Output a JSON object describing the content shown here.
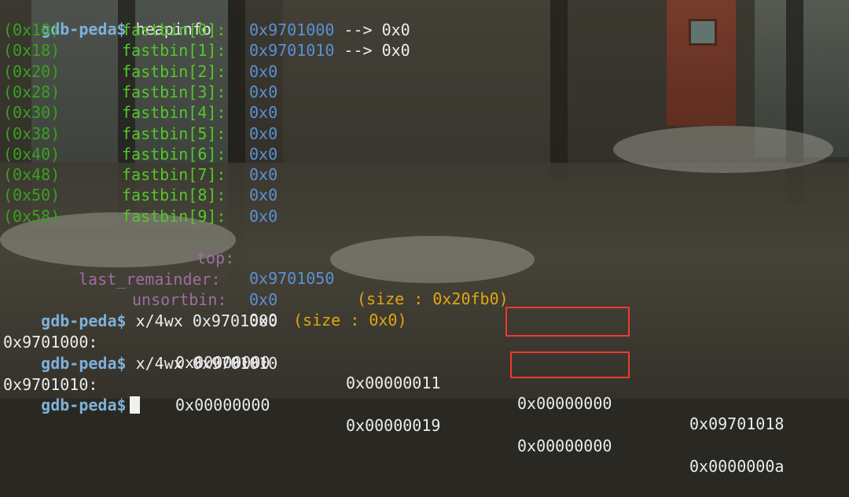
{
  "prompt": "gdb-peda$",
  "command_heapinfo": "heapinfo",
  "fastbins": [
    {
      "size": "(0x10)",
      "label": "fastbin[0]:",
      "value": "0x9701000 --> 0x0"
    },
    {
      "size": "(0x18)",
      "label": "fastbin[1]:",
      "value": "0x9701010 --> 0x0"
    },
    {
      "size": "(0x20)",
      "label": "fastbin[2]:",
      "value": "0x0"
    },
    {
      "size": "(0x28)",
      "label": "fastbin[3]:",
      "value": "0x0"
    },
    {
      "size": "(0x30)",
      "label": "fastbin[4]:",
      "value": "0x0"
    },
    {
      "size": "(0x38)",
      "label": "fastbin[5]:",
      "value": "0x0"
    },
    {
      "size": "(0x40)",
      "label": "fastbin[6]:",
      "value": "0x0"
    },
    {
      "size": "(0x48)",
      "label": "fastbin[7]:",
      "value": "0x0"
    },
    {
      "size": "(0x50)",
      "label": "fastbin[8]:",
      "value": "0x0"
    },
    {
      "size": "(0x58)",
      "label": "fastbin[9]:",
      "value": "0x0"
    }
  ],
  "top": {
    "label": "top:",
    "value": "0x9701050",
    "size": "(size : 0x20fb0)"
  },
  "last_remainder": {
    "label": "last_remainder:",
    "value": "0x0",
    "size": "(size : 0x0)"
  },
  "unsortbin": {
    "label": "unsortbin:",
    "value": "0x0"
  },
  "examine_1": {
    "command": "x/4wx 0x9701000",
    "address": "0x9701000:",
    "words": [
      "0x00000000",
      "0x00000011",
      "0x00000000",
      "0x09701018"
    ]
  },
  "examine_2": {
    "command": "x/4wx 0x9701010",
    "address": "0x9701010:",
    "words": [
      "0x00000000",
      "0x00000019",
      "0x00000000",
      "0x0000000a"
    ]
  },
  "colors": {
    "prompt": "#7fb0da",
    "fastbin_label": "#55c729",
    "pointer_value": "#5b91d5",
    "arena_label": "#9d6ea2",
    "size_info": "#e0a70e",
    "highlight_box": "#ef3a2c"
  }
}
